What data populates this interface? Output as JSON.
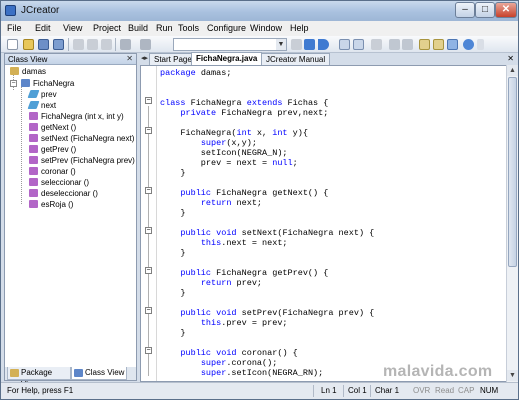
{
  "window": {
    "title": "JCreator",
    "min_label": "–",
    "max_label": "□",
    "close_label": "✕"
  },
  "menu": [
    "File",
    "Edit",
    "View",
    "Project",
    "Build",
    "Run",
    "Tools",
    "Configure",
    "Window",
    "Help"
  ],
  "class_view": {
    "title": "Class View",
    "close_label": "✕",
    "root": "damas",
    "class_name": "FichaNegra",
    "members": [
      {
        "label": "prev",
        "kind": "field"
      },
      {
        "label": "next",
        "kind": "field"
      },
      {
        "label": "FichaNegra (int x, int y)",
        "kind": "method"
      },
      {
        "label": "getNext ()",
        "kind": "method"
      },
      {
        "label": "setNext (FichaNegra next)",
        "kind": "method"
      },
      {
        "label": "getPrev ()",
        "kind": "method"
      },
      {
        "label": "setPrev (FichaNegra prev)",
        "kind": "method"
      },
      {
        "label": "coronar ()",
        "kind": "method"
      },
      {
        "label": "seleccionar ()",
        "kind": "method"
      },
      {
        "label": "deseleccionar ()",
        "kind": "method"
      },
      {
        "label": "esRoja ()",
        "kind": "method"
      }
    ],
    "tabs": [
      "Package View",
      "Class View"
    ]
  },
  "editor": {
    "tabs": [
      "Start Page",
      "FichaNegra.java",
      "JCreator Manual"
    ],
    "active_tab": "FichaNegra.java",
    "close_label": "✕",
    "code": [
      [
        [
          "k",
          "package"
        ],
        [
          "t",
          " damas;"
        ]
      ],
      [],
      [],
      [
        [
          "k",
          "class"
        ],
        [
          "t",
          " FichaNegra "
        ],
        [
          "k",
          "extends"
        ],
        [
          "t",
          " Fichas {"
        ]
      ],
      [
        [
          "t",
          "    "
        ],
        [
          "k",
          "private"
        ],
        [
          "t",
          " FichaNegra prev,next;"
        ]
      ],
      [],
      [
        [
          "t",
          "    FichaNegra("
        ],
        [
          "k",
          "int"
        ],
        [
          "t",
          " x, "
        ],
        [
          "k",
          "int"
        ],
        [
          "t",
          " y){"
        ]
      ],
      [
        [
          "t",
          "        "
        ],
        [
          "k",
          "super"
        ],
        [
          "t",
          "(x,y);"
        ]
      ],
      [
        [
          "t",
          "        setIcon(NEGRA_N);"
        ]
      ],
      [
        [
          "t",
          "        prev = next = "
        ],
        [
          "k",
          "null"
        ],
        [
          "t",
          ";"
        ]
      ],
      [
        [
          "t",
          "    }"
        ]
      ],
      [],
      [
        [
          "t",
          "    "
        ],
        [
          "k",
          "public"
        ],
        [
          "t",
          " FichaNegra getNext() {"
        ]
      ],
      [
        [
          "t",
          "        "
        ],
        [
          "k",
          "return"
        ],
        [
          "t",
          " next;"
        ]
      ],
      [
        [
          "t",
          "    }"
        ]
      ],
      [],
      [
        [
          "t",
          "    "
        ],
        [
          "k",
          "public"
        ],
        [
          "t",
          " "
        ],
        [
          "k",
          "void"
        ],
        [
          "t",
          " setNext(FichaNegra next) {"
        ]
      ],
      [
        [
          "t",
          "        "
        ],
        [
          "k",
          "this"
        ],
        [
          "t",
          ".next = next;"
        ]
      ],
      [
        [
          "t",
          "    }"
        ]
      ],
      [],
      [
        [
          "t",
          "    "
        ],
        [
          "k",
          "public"
        ],
        [
          "t",
          " FichaNegra getPrev() {"
        ]
      ],
      [
        [
          "t",
          "        "
        ],
        [
          "k",
          "return"
        ],
        [
          "t",
          " prev;"
        ]
      ],
      [
        [
          "t",
          "    }"
        ]
      ],
      [],
      [
        [
          "t",
          "    "
        ],
        [
          "k",
          "public"
        ],
        [
          "t",
          " "
        ],
        [
          "k",
          "void"
        ],
        [
          "t",
          " setPrev(FichaNegra prev) {"
        ]
      ],
      [
        [
          "t",
          "        "
        ],
        [
          "k",
          "this"
        ],
        [
          "t",
          ".prev = prev;"
        ]
      ],
      [
        [
          "t",
          "    }"
        ]
      ],
      [],
      [
        [
          "t",
          "    "
        ],
        [
          "k",
          "public"
        ],
        [
          "t",
          " "
        ],
        [
          "k",
          "void"
        ],
        [
          "t",
          " coronar() {"
        ]
      ],
      [
        [
          "t",
          "        "
        ],
        [
          "k",
          "super"
        ],
        [
          "t",
          ".corona();"
        ]
      ],
      [
        [
          "t",
          "        "
        ],
        [
          "k",
          "super"
        ],
        [
          "t",
          ".setIcon(NEGRA_RN);"
        ]
      ]
    ]
  },
  "status": {
    "hint": "For Help, press F1",
    "line": "Ln 1",
    "col": "Col 1",
    "char": "Char 1",
    "ovr": "OVR",
    "read": "Read",
    "cap": "CAP",
    "num": "NUM"
  },
  "watermark": "malavida.com",
  "colors": {
    "keyword": "#0000ff",
    "text": "#000000",
    "title_gradient": "#a9c1df"
  }
}
